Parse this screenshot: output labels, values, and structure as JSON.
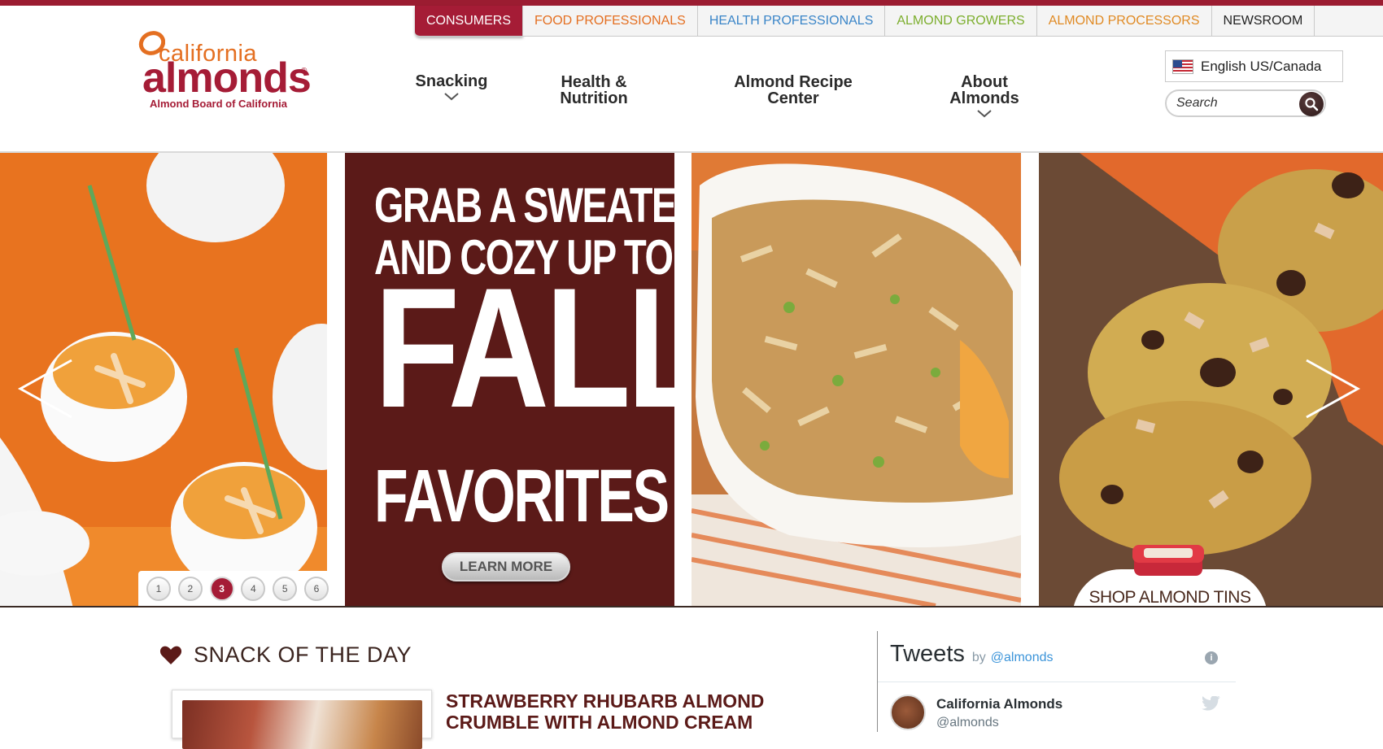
{
  "audience_tabs": [
    {
      "label": "CONSUMERS",
      "active": true
    },
    {
      "label": "FOOD PROFESSIONALS"
    },
    {
      "label": "HEALTH PROFESSIONALS"
    },
    {
      "label": "ALMOND GROWERS"
    },
    {
      "label": "ALMOND PROCESSORS"
    },
    {
      "label": "NEWSROOM"
    }
  ],
  "logo": {
    "california": "california",
    "almonds": "almonds",
    "registered": "®",
    "board": "Almond Board of California"
  },
  "main_nav": [
    {
      "label": "Snacking",
      "has_dropdown": true
    },
    {
      "label": "Health &\nNutrition"
    },
    {
      "label": "Almond Recipe\nCenter"
    },
    {
      "label": "About\nAlmonds",
      "has_dropdown": true
    }
  ],
  "language": {
    "label": "English US/Canada",
    "icon": "us-flag-icon"
  },
  "search": {
    "placeholder": "Search",
    "icon": "magnifier-icon"
  },
  "hero": {
    "line1": "GRAB A SWEATER",
    "line2": "AND COZY UP TO",
    "line3": "FALL",
    "line4": "FAVORITES",
    "cta": "LEARN MORE",
    "shop_label": "SHOP ALMOND TINS",
    "pagination": [
      "1",
      "2",
      "3",
      "4",
      "5",
      "6"
    ],
    "active_slide": 3,
    "prev_icon": "chevron-left-icon",
    "next_icon": "chevron-right-icon"
  },
  "snack": {
    "heading": "SNACK OF THE DAY",
    "icon": "heart-icon",
    "title": "STRAWBERRY RHUBARB ALMOND CRUMBLE WITH ALMOND CREAM"
  },
  "tweets": {
    "title": "Tweets",
    "by": "by",
    "handle": "@almonds",
    "author_name": "California Almonds",
    "author_handle": "@almonds"
  },
  "colors": {
    "brand": "#a51c36",
    "orange": "#e46f21",
    "dark_brown": "#5b1a18"
  }
}
